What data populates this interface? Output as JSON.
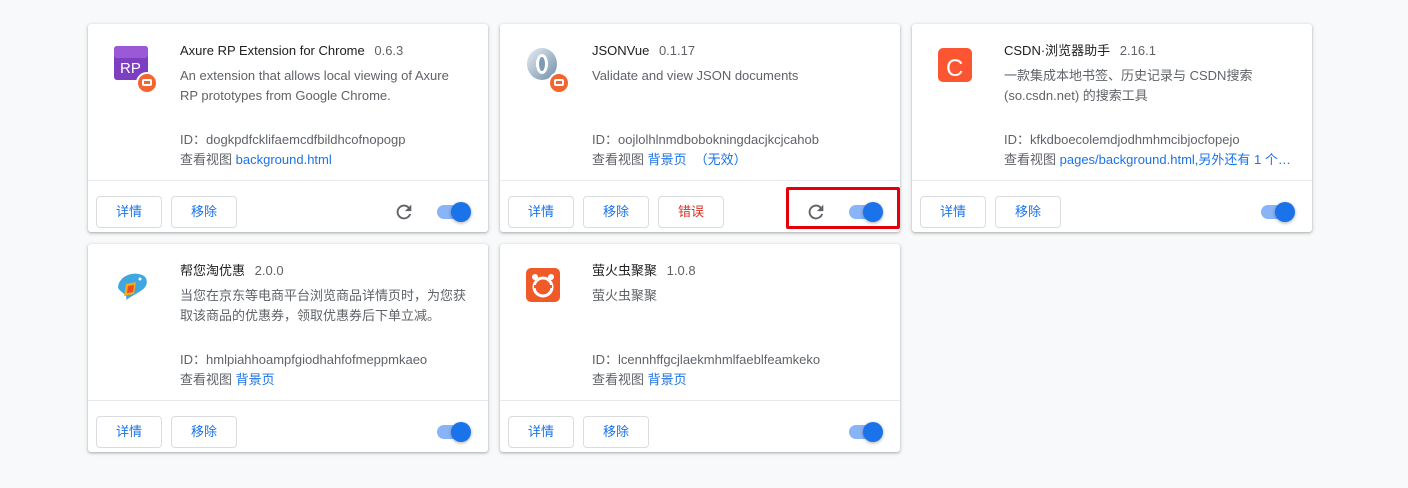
{
  "common": {
    "details_label": "详情",
    "remove_label": "移除",
    "errors_label": "错误",
    "view_prefix": "查看视图",
    "id_prefix": "ID："
  },
  "extensions": [
    {
      "name": "Axure RP Extension for Chrome",
      "version": "0.6.3",
      "description": "An extension that allows local viewing of Axure RP prototypes from Google Chrome.",
      "id": "dogkpdfcklifaemcdfbildhcofnopogp",
      "view_link": "background.html",
      "view_extra": "",
      "enabled": true,
      "icon": "axure-rp-icon"
    },
    {
      "name": "JSONVue",
      "version": "0.1.17",
      "description": "Validate and view JSON documents",
      "id": "oojlolhlnmdbobokningdacjkcjcahob",
      "view_link": "背景页",
      "view_extra": "（无效）",
      "enabled": true,
      "icon": "jsonvue-icon"
    },
    {
      "name": "CSDN·浏览器助手",
      "version": "2.16.1",
      "description": "一款集成本地书签、历史记录与 CSDN搜索(so.csdn.net) 的搜索工具",
      "id": "kfkdboecolemdjodhmhmcibjocfopejo",
      "view_link": "pages/background.html,另外还有 1 个…",
      "view_extra": "",
      "enabled": true,
      "icon": "csdn-icon"
    },
    {
      "name": "帮您淘优惠",
      "version": "2.0.0",
      "description": "当您在京东等电商平台浏览商品详情页时，为您获取该商品的优惠券，领取优惠券后下单立减。",
      "id": "hmlpiahhoampfgiodhahfofmeppmkaeo",
      "view_link": "背景页",
      "view_extra": "",
      "enabled": true,
      "icon": "dolphin-icon"
    },
    {
      "name": "萤火虫聚聚",
      "version": "1.0.8",
      "description": "萤火虫聚聚",
      "id": "lcennhffgcjlaekmhmlfaeblfeamkeko",
      "view_link": "背景页",
      "view_extra": "",
      "enabled": true,
      "icon": "firefly-icon"
    }
  ],
  "colors": {
    "accent": "#1a73e8",
    "toggle_track": "#8ab4f8",
    "error": "#d93025",
    "highlight": "#e3000b"
  }
}
